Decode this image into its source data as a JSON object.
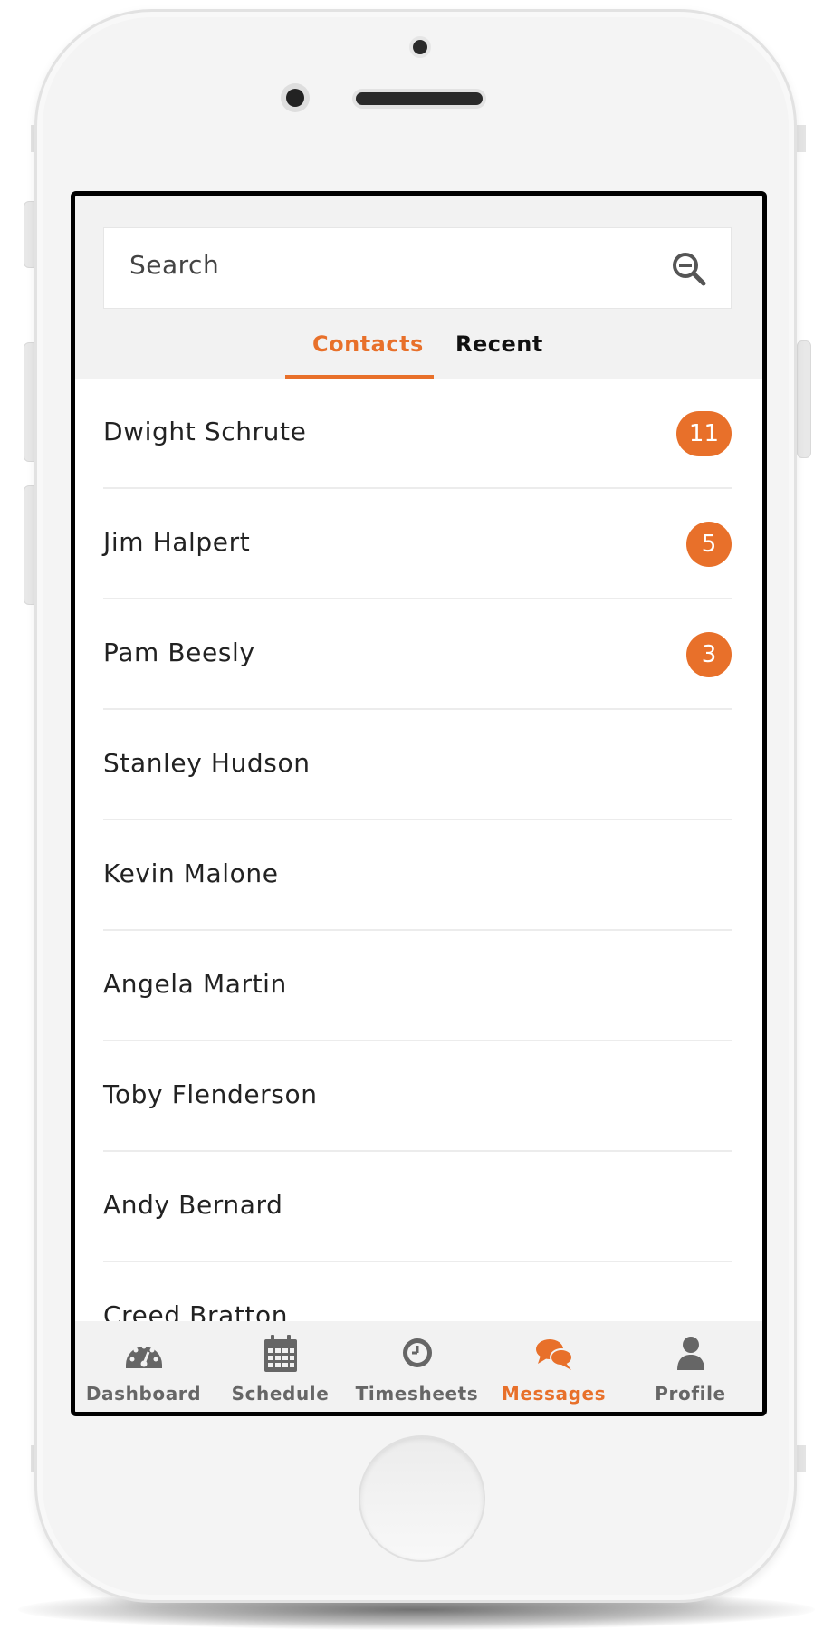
{
  "search": {
    "placeholder": "Search"
  },
  "tabs": [
    {
      "label": "Contacts",
      "active": true
    },
    {
      "label": "Recent",
      "active": false
    }
  ],
  "contacts": [
    {
      "name": "Dwight Schrute",
      "badge": "11"
    },
    {
      "name": "Jim Halpert",
      "badge": "5"
    },
    {
      "name": "Pam Beesly",
      "badge": "3"
    },
    {
      "name": "Stanley Hudson"
    },
    {
      "name": "Kevin Malone"
    },
    {
      "name": "Angela Martin"
    },
    {
      "name": "Toby Flenderson"
    },
    {
      "name": "Andy Bernard"
    },
    {
      "name": "Creed Bratton"
    }
  ],
  "nav": [
    {
      "label": "Dashboard",
      "icon": "dashboard-gauge-icon"
    },
    {
      "label": "Schedule",
      "icon": "calendar-icon"
    },
    {
      "label": "Timesheets",
      "icon": "clock-icon"
    },
    {
      "label": "Messages",
      "icon": "chat-bubbles-icon",
      "active": true
    },
    {
      "label": "Profile",
      "icon": "user-icon"
    }
  ],
  "colors": {
    "accent": "#e8702a",
    "nav_inactive": "#666666"
  }
}
